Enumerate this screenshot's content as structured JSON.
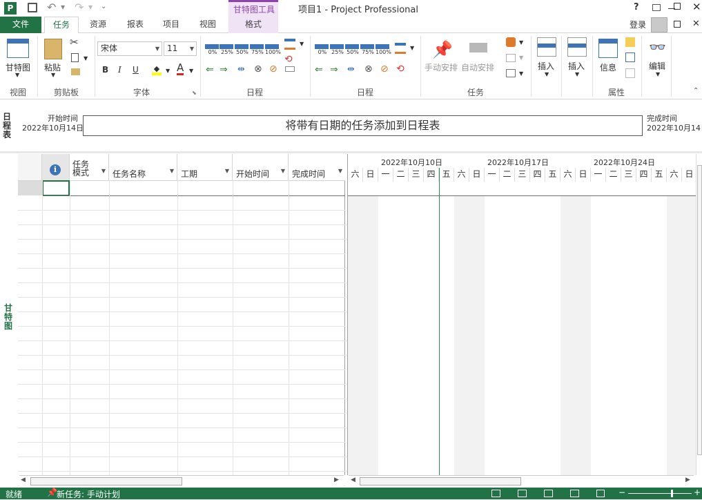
{
  "window": {
    "title": "项目1 - Project Professional",
    "contextual_tool": "甘特图工具",
    "login": "登录",
    "help": "?"
  },
  "tabs": [
    "文件",
    "任务",
    "资源",
    "报表",
    "项目",
    "视图",
    "格式"
  ],
  "ribbon": {
    "view_group": {
      "button": "甘特图",
      "label": "视图"
    },
    "clipboard_group": {
      "paste": "粘贴",
      "label": "剪贴板"
    },
    "font_group": {
      "font_name": "宋体",
      "font_size": "11",
      "bold": "B",
      "italic": "I",
      "underline": "U",
      "font_color": "A",
      "label": "字体"
    },
    "schedule_group1": {
      "percents": [
        "0%",
        "25%",
        "50%",
        "75%",
        "100%"
      ],
      "label": "日程"
    },
    "schedule_group2": {
      "percents": [
        "0%",
        "25%",
        "50%",
        "75%",
        "100%"
      ],
      "label": "日程"
    },
    "tasks_group": {
      "manual": "手动安排",
      "auto": "自动安排",
      "label": "任务"
    },
    "insert1": "插入",
    "insert2": "插入",
    "properties_group": {
      "info": "信息",
      "label": "属性"
    },
    "edit": "编辑"
  },
  "timeline": {
    "side_label": "日程表",
    "start_label": "开始时间",
    "start_date": "2022年10月14日",
    "end_label": "完成时间",
    "end_date": "2022年10月14日",
    "placeholder": "将带有日期的任务添加到日程表"
  },
  "gantt_side_label": "甘特图",
  "table": {
    "columns": [
      "任务\n模式",
      "任务名称",
      "工期",
      "开始时间",
      "完成时间"
    ]
  },
  "gantt": {
    "weeks": [
      "2022年10月10日",
      "2022年10月17日",
      "2022年10月24日"
    ],
    "days": [
      "六",
      "日",
      "一",
      "二",
      "三",
      "四",
      "五",
      "六",
      "日",
      "一",
      "二",
      "三",
      "四",
      "五",
      "六",
      "日",
      "一",
      "二",
      "三",
      "四",
      "五",
      "六",
      "日"
    ]
  },
  "status": {
    "ready": "就绪",
    "new_task": "新任务: 手动计划"
  },
  "colors": {
    "accent": "#217346",
    "file_tab": "#217346",
    "tool_purple": "#8e44ad",
    "bar_blue": "#3c74b7"
  }
}
